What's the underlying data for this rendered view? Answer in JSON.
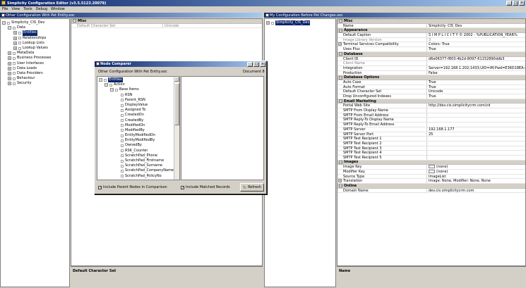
{
  "app": {
    "title": "Simplicity Configuration Editor (v3.5.5123.20079)"
  },
  "menu": [
    "File",
    "View",
    "Tools",
    "Debug",
    "Window"
  ],
  "left_panel": {
    "title": "Other Configuration With Pet Entity.xoc",
    "tree": [
      {
        "label": "Simplicity_CIS_Dev",
        "level": 0,
        "exp": "-"
      },
      {
        "label": "Data",
        "level": 1,
        "exp": "-"
      },
      {
        "label": "Entities",
        "level": 2,
        "exp": "+",
        "selected": true
      },
      {
        "label": "Relationships",
        "level": 2,
        "exp": "+"
      },
      {
        "label": "Lookup Lists",
        "level": 2,
        "exp": "+"
      },
      {
        "label": "Lookup Values",
        "level": 2,
        "exp": "+"
      },
      {
        "label": "MetaData",
        "level": 1,
        "exp": "+"
      },
      {
        "label": "Business Processes",
        "level": 1,
        "exp": "+"
      },
      {
        "label": "User Interfaces",
        "level": 1,
        "exp": "+"
      },
      {
        "label": "Data Loads",
        "level": 1,
        "exp": "+"
      },
      {
        "label": "Data Providers",
        "level": 1,
        "exp": "+"
      },
      {
        "label": "Behaviour",
        "level": 1,
        "exp": "+"
      },
      {
        "label": "Security",
        "level": 1,
        "exp": "+"
      }
    ]
  },
  "middle_panel": {
    "category": "Misc",
    "prop_name": "Default Character Set",
    "prop_value": "Unicode",
    "description": "Default Character Set"
  },
  "right_panel": {
    "title": "My Configuration Before Pet Changes.xoc",
    "tree_root": "Simplicity_CIS_Dev",
    "description": "Name",
    "grid": [
      {
        "name": "Misc",
        "category": true
      },
      {
        "name": "Name",
        "value": "Simplicity_CIS_Dev"
      },
      {
        "name": "Appearance",
        "category": true
      },
      {
        "name": "Default Caption",
        "value": "S I M P L I C I T Y  © 2002 - %PUBLICATION_YEAR%"
      },
      {
        "name": "Image Library Version",
        "value": "3",
        "grey": true
      },
      {
        "name": "Terminal Services Compatibility",
        "value": "Colors: True",
        "expand": true
      },
      {
        "name": "Uses Plus",
        "value": "True"
      },
      {
        "name": "Database",
        "category": true
      },
      {
        "name": "Client ID",
        "value": "d6e06377-f803-4b2d-8097-61152890ddb3"
      },
      {
        "name": "Client Name",
        "value": "",
        "grey": true
      },
      {
        "name": "Integration",
        "value": "Server=192.168.1.202;1433;UID=iM;Pwd=E36D18EA-4053-4204-8C04-C02C6B82F2C1"
      },
      {
        "name": "Production",
        "value": "False"
      },
      {
        "name": "Database Options",
        "category": true
      },
      {
        "name": "Auto Case",
        "value": "True"
      },
      {
        "name": "Auto Format",
        "value": "True"
      },
      {
        "name": "Default Character Set",
        "value": "Unicode"
      },
      {
        "name": "Drop Unconfigured Indexes",
        "value": "True"
      },
      {
        "name": "Email Marketing",
        "category": true
      },
      {
        "name": "Portal Web Site",
        "value": "http://dev.cis.simplicitycrm.com/cd"
      },
      {
        "name": "SMTP From Display Name",
        "value": ""
      },
      {
        "name": "SMTP From Email Address",
        "value": ""
      },
      {
        "name": "SMTP Reply-To Display Name",
        "value": ""
      },
      {
        "name": "SMTP Reply-To Email Address",
        "value": ""
      },
      {
        "name": "SMTP Server",
        "value": "192.168.1.177"
      },
      {
        "name": "SMTP Server Port",
        "value": "25"
      },
      {
        "name": "SMTP Test Recipient 1",
        "value": ""
      },
      {
        "name": "SMTP Test Recipient 2",
        "value": ""
      },
      {
        "name": "SMTP Test Recipient 3",
        "value": ""
      },
      {
        "name": "SMTP Test Recipient 4",
        "value": ""
      },
      {
        "name": "SMTP Test Recipient 5",
        "value": ""
      },
      {
        "name": "Images",
        "category": true
      },
      {
        "name": "Image Key",
        "value": "(none)",
        "swatch": true
      },
      {
        "name": "Modifier Key",
        "value": "(none)",
        "swatch": true
      },
      {
        "name": "Source Type",
        "value": "ImageList"
      },
      {
        "name": "Translation",
        "value": "Image: None, Modifier: None, None",
        "expand": true
      },
      {
        "name": "Online",
        "category": true
      },
      {
        "name": "Domain Name",
        "value": "dev.cis.simplicitycrm.com"
      }
    ]
  },
  "dialog": {
    "title": "Node Comparer",
    "left_label": "Other Configuration With Pet Entity.xoc",
    "right_label": "Document 8",
    "tree": [
      {
        "label": "Entities",
        "level": 0,
        "exp": "-",
        "selected": true
      },
      {
        "label": "Action",
        "level": 1,
        "exp": "-"
      },
      {
        "label": "Base Items",
        "level": 2,
        "exp": "-"
      },
      {
        "label": "RSN",
        "level": 3
      },
      {
        "label": "Parent_RSN",
        "level": 3
      },
      {
        "label": "DisplayValue",
        "level": 3
      },
      {
        "label": "Assigned To",
        "level": 3
      },
      {
        "label": "CreatedOn",
        "level": 3
      },
      {
        "label": "CreatedBy",
        "level": 3
      },
      {
        "label": "ModifiedOn",
        "level": 3
      },
      {
        "label": "ModifiedBy",
        "level": 3
      },
      {
        "label": "EntityModifiedOn",
        "level": 3
      },
      {
        "label": "EntityModifiedBy",
        "level": 3
      },
      {
        "label": "OwnedBy",
        "level": 3
      },
      {
        "label": "RSK_Counter",
        "level": 3
      },
      {
        "label": "ScratchPad_Phone",
        "level": 3
      },
      {
        "label": "ScratchPad_Firstname",
        "level": 3
      },
      {
        "label": "ScratchPad_Surname",
        "level": 3
      },
      {
        "label": "ScratchPad_CompanyName",
        "level": 3
      },
      {
        "label": "ScratchPad_PolicyNo",
        "level": 3
      }
    ],
    "include_parent_label": "Include Parent Nodes in Comparison",
    "include_parent_checked": true,
    "include_matched_label": "Include Matched Records",
    "include_matched_checked": true,
    "refresh_label": "Refresh"
  },
  "colors": {
    "title_start": "#0a246a",
    "title_end": "#a6caf0",
    "face": "#d4d0c8"
  }
}
